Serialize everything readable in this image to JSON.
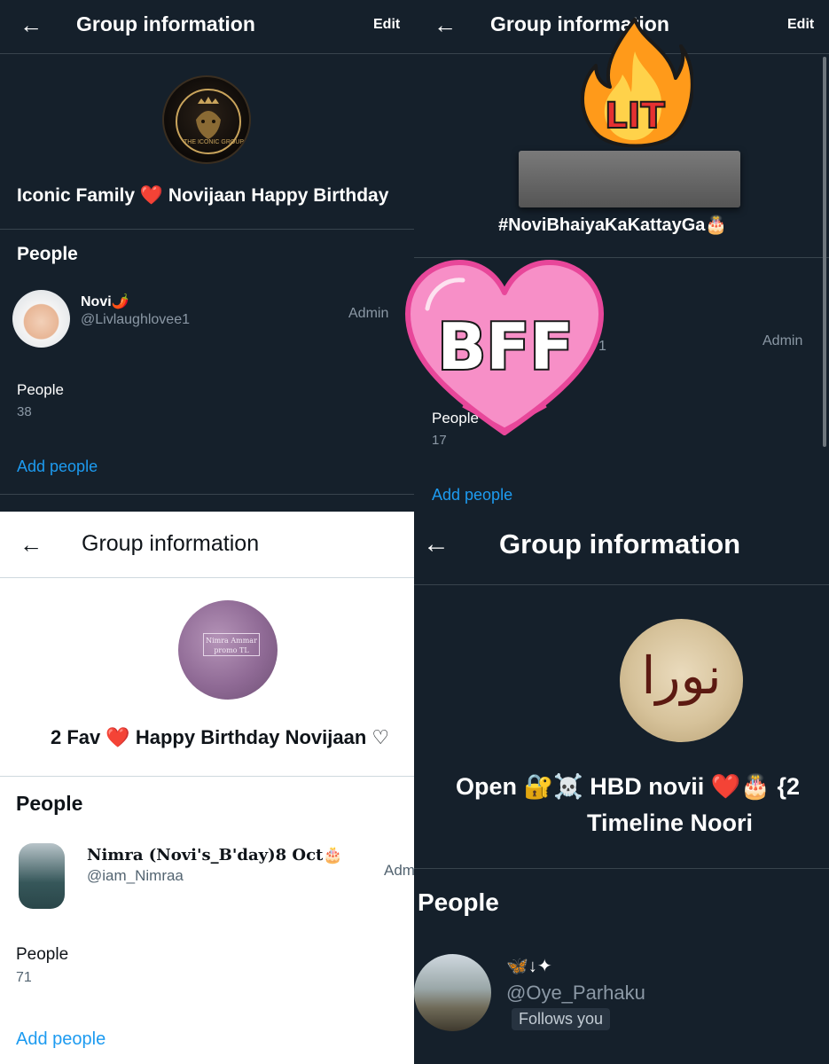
{
  "panel1": {
    "title": "Group information",
    "edit_label": "Edit",
    "group_name": "Iconic Family ❤️ Novijaan Happy Birthday",
    "avatar_text": "THE ICONIC GROUP",
    "people_heading": "People",
    "member": {
      "name": "Novi🌶️",
      "handle": "@Livlaughlovee1",
      "role": "Admin"
    },
    "count_label": "People",
    "count_value": "38",
    "add_people": "Add people"
  },
  "panel2": {
    "title": "Group information",
    "edit_label": "Edit",
    "group_name": "#NoviBhaiyaKaKattayGa🎂",
    "member_handle_fragment": "1",
    "member_role": "Admin",
    "count_label": "People",
    "count_value": "17",
    "add_people": "Add people",
    "sticker_fire_text": "LIT",
    "sticker_heart_text": "BFF"
  },
  "panel3": {
    "title": "Group information",
    "avatar_text": "Nimra Ammar promo TL",
    "group_name": "2 Fav ❤️ Happy Birthday Novijaan ♡",
    "people_heading": "People",
    "member": {
      "name": "Nimra (Novi's_B'day)8 Oct🎂",
      "handle": "@iam_Nimraa",
      "role": "Adm"
    },
    "count_label": "People",
    "count_value": "71",
    "add_people": "Add people"
  },
  "panel4": {
    "title": "Group information",
    "avatar_text": "نورا",
    "group_name_line1": "Open 🔐☠️ HBD novii ❤️🎂 {2",
    "group_name_line2": "Timeline Noori",
    "people_heading": "People",
    "member": {
      "name": "🦋↓✦",
      "handle": "@Oye_Parhaku",
      "badge": "Follows you"
    }
  },
  "colors": {
    "dark_bg": "#15202b",
    "light_bg": "#ffffff",
    "link": "#1d9bf0",
    "muted": "#8b98a5"
  },
  "icons": [
    "back-arrow-icon",
    "fire-sticker",
    "heart-sticker"
  ]
}
